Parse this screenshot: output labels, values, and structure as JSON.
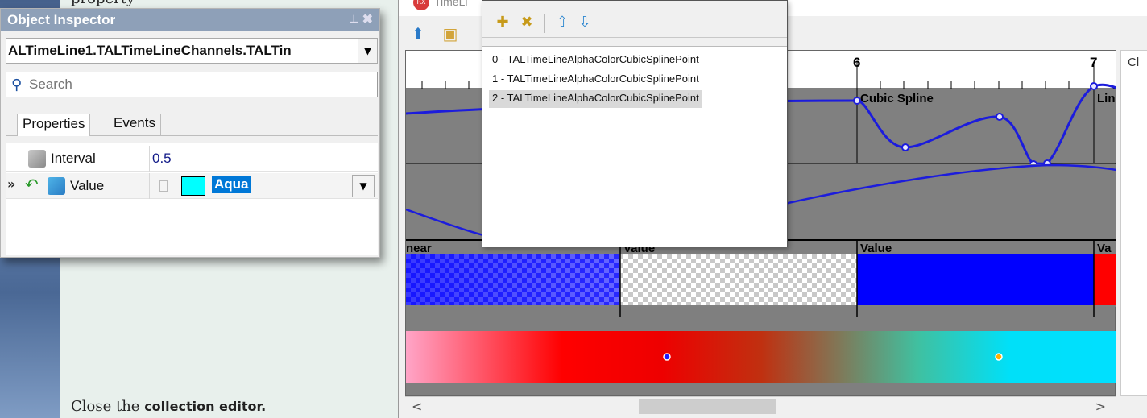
{
  "tutorial": {
    "top_fragment": "property",
    "close_prefix": "Close the ",
    "close_bold": "collection editor."
  },
  "object_inspector": {
    "title": "Object Inspector",
    "component": "ALTimeLine1.TALTimeLineChannels.TALTin",
    "search_placeholder": "Search",
    "tabs": [
      "Properties",
      "Events"
    ],
    "properties": [
      {
        "name": "Interval",
        "value": "0.5"
      },
      {
        "name": "Value",
        "value": "Aqua"
      }
    ],
    "value_color": "#00ffff"
  },
  "timeline": {
    "window_title": "TimeLi",
    "ruler_labels": [
      "6",
      "7"
    ],
    "channel_labels": [
      "Cubic Spline",
      "Lin",
      "near",
      "Value",
      "Value",
      "Va"
    ],
    "right_panel_label": "Cl",
    "colors": {
      "blue": "#0000ff",
      "red": "#ff0000",
      "aqua": "#00ffff",
      "track": "#808080"
    }
  },
  "collection_editor": {
    "items": [
      "0 - TALTimeLineAlphaColorCubicSplinePoint",
      "1 - TALTimeLineAlphaColorCubicSplinePoint",
      "2 - TALTimeLineAlphaColorCubicSplinePoint"
    ],
    "selected_index": 2
  }
}
